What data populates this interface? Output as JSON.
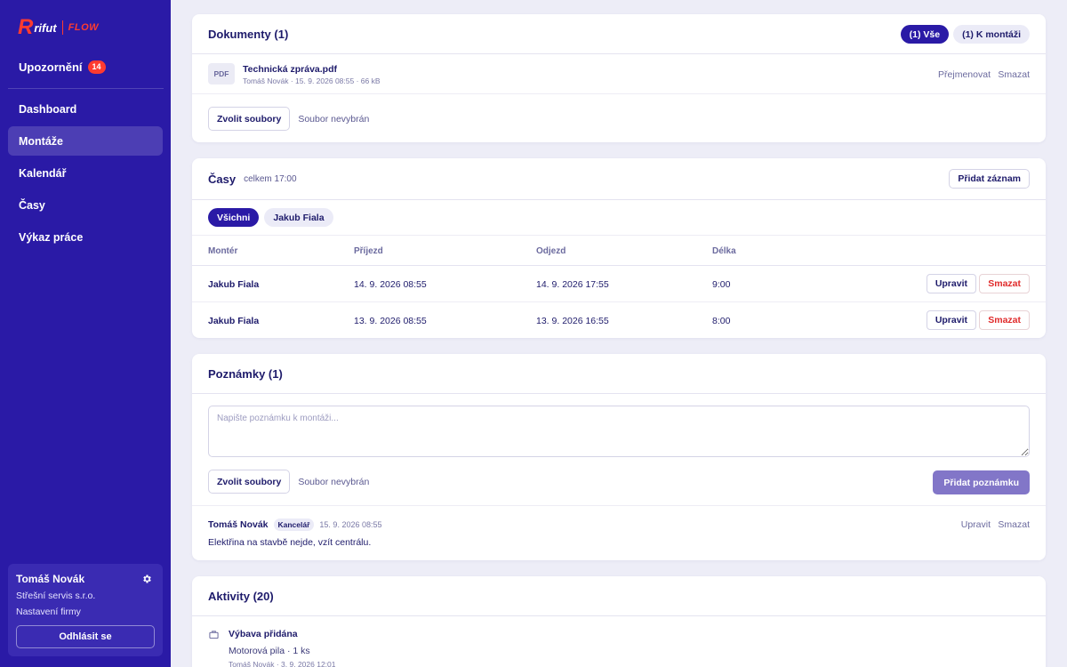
{
  "brand": {
    "mark": "R",
    "name": "rifut",
    "product": "FLOW"
  },
  "sidebar": {
    "notifications": {
      "label": "Upozornění",
      "count": "14"
    },
    "nav": [
      {
        "label": "Dashboard",
        "active": false
      },
      {
        "label": "Montáže",
        "active": true
      },
      {
        "label": "Kalendář",
        "active": false
      },
      {
        "label": "Časy",
        "active": false
      },
      {
        "label": "Výkaz práce",
        "active": false
      }
    ],
    "user": {
      "name": "Tomáš Novák",
      "company": "Střešní servis s.r.o.",
      "settings_link": "Nastavení firmy",
      "logout": "Odhlásit se"
    }
  },
  "documents": {
    "title": "Dokumenty (1)",
    "filters": [
      "(1) Vše",
      "(1) K montáži"
    ],
    "files": [
      {
        "type": "PDF",
        "name": "Technická zpráva.pdf",
        "meta": "Tomáš Novák · 15. 9. 2026 08:55 · 66 kB",
        "rename": "Přejmenovat",
        "delete": "Smazat"
      }
    ],
    "choose_files": "Zvolit soubory",
    "no_file": "Soubor nevybrán"
  },
  "times": {
    "title": "Časy",
    "total": "celkem 17:00",
    "add_button": "Přidat záznam",
    "filters": [
      "Všichni",
      "Jakub Fiala"
    ],
    "columns": [
      "Montér",
      "Příjezd",
      "Odjezd",
      "Délka"
    ],
    "rows": [
      {
        "worker": "Jakub Fiala",
        "arrival": "14. 9. 2026 08:55",
        "departure": "14. 9. 2026 17:55",
        "duration": "9:00"
      },
      {
        "worker": "Jakub Fiala",
        "arrival": "13. 9. 2026 08:55",
        "departure": "13. 9. 2026 16:55",
        "duration": "8:00"
      }
    ],
    "edit": "Upravit",
    "delete": "Smazat"
  },
  "notes": {
    "title": "Poznámky (1)",
    "placeholder": "Napište poznámku k montáži...",
    "choose_files": "Zvolit soubory",
    "no_file": "Soubor nevybrán",
    "add_button": "Přidat poznámku",
    "items": [
      {
        "author": "Tomáš Novák",
        "role": "Kancelář",
        "date": "15. 9. 2026 08:55",
        "text": "Elektřina na stavbě nejde, vzít centrálu.",
        "edit": "Upravit",
        "delete": "Smazat"
      }
    ]
  },
  "activities": {
    "title": "Aktivity (20)",
    "items": [
      {
        "icon": "toolbox-icon",
        "title": "Výbava přidána",
        "detail": "Motorová pila · 1 ks",
        "meta": "Tomáš Novák · 3. 9. 2026 12:01"
      }
    ]
  },
  "colors": {
    "sidebar": "#2a1aa6",
    "accent": "#ff3b30",
    "primary_muted": "#8276c8",
    "danger": "#e02b2b"
  }
}
